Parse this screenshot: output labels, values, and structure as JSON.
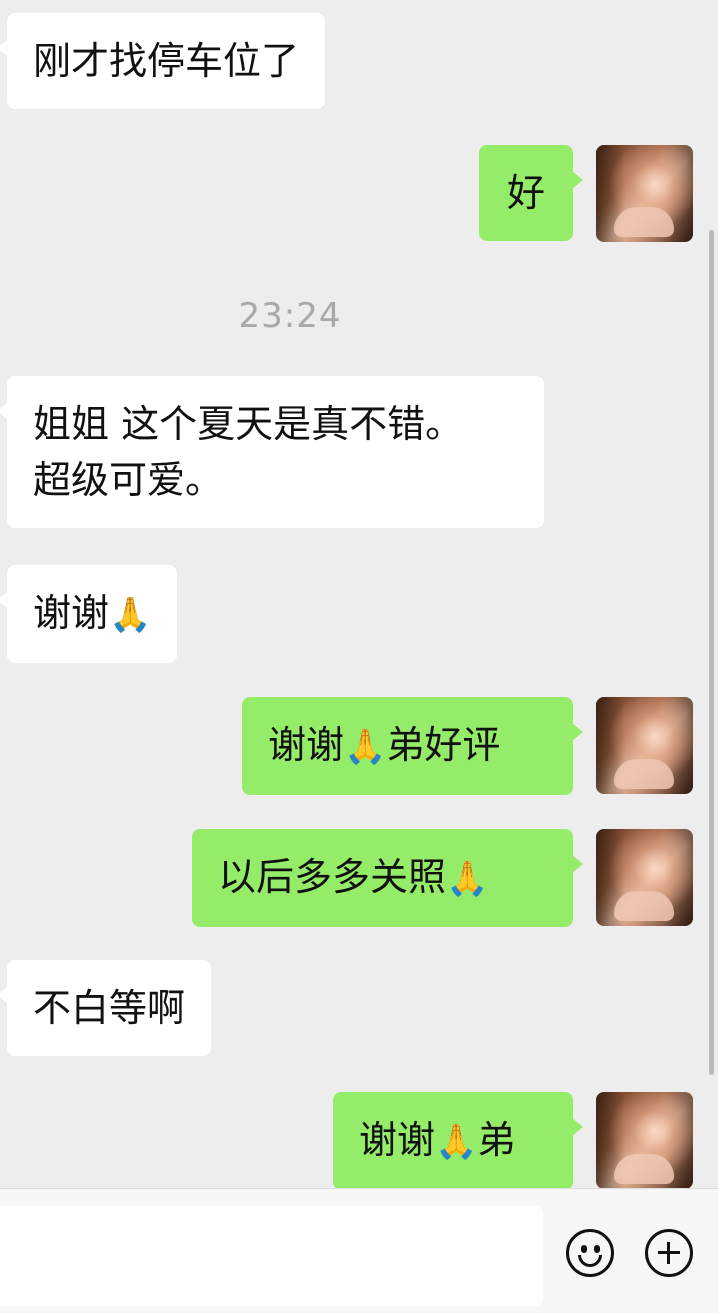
{
  "messages": [
    {
      "side": "left",
      "text": "刚才找停车位了"
    },
    {
      "side": "right",
      "text": "好"
    },
    {
      "timestamp": "23:24"
    },
    {
      "side": "left",
      "line1": "姐姐 这个夏天是真不错。",
      "line2": "超级可爱。"
    },
    {
      "side": "left",
      "text": "谢谢",
      "emoji": "🙏"
    },
    {
      "side": "right",
      "text_before": "谢谢",
      "emoji": "🙏",
      "text_after": "弟好评"
    },
    {
      "side": "right",
      "text": "以后多多关照",
      "emoji": "🙏"
    },
    {
      "side": "left",
      "text": "不白等啊"
    },
    {
      "side": "right",
      "text_before": "谢谢",
      "emoji": "🙏",
      "text_after": "弟"
    }
  ],
  "input": {
    "placeholder": ""
  },
  "icons": {
    "emoji_button": "smiley-face-icon",
    "more_button": "plus-circle-icon"
  },
  "colors": {
    "background": "#ededed",
    "outgoing_bubble": "#95ec69",
    "incoming_bubble": "#ffffff",
    "timestamp": "#a8a8a8"
  }
}
